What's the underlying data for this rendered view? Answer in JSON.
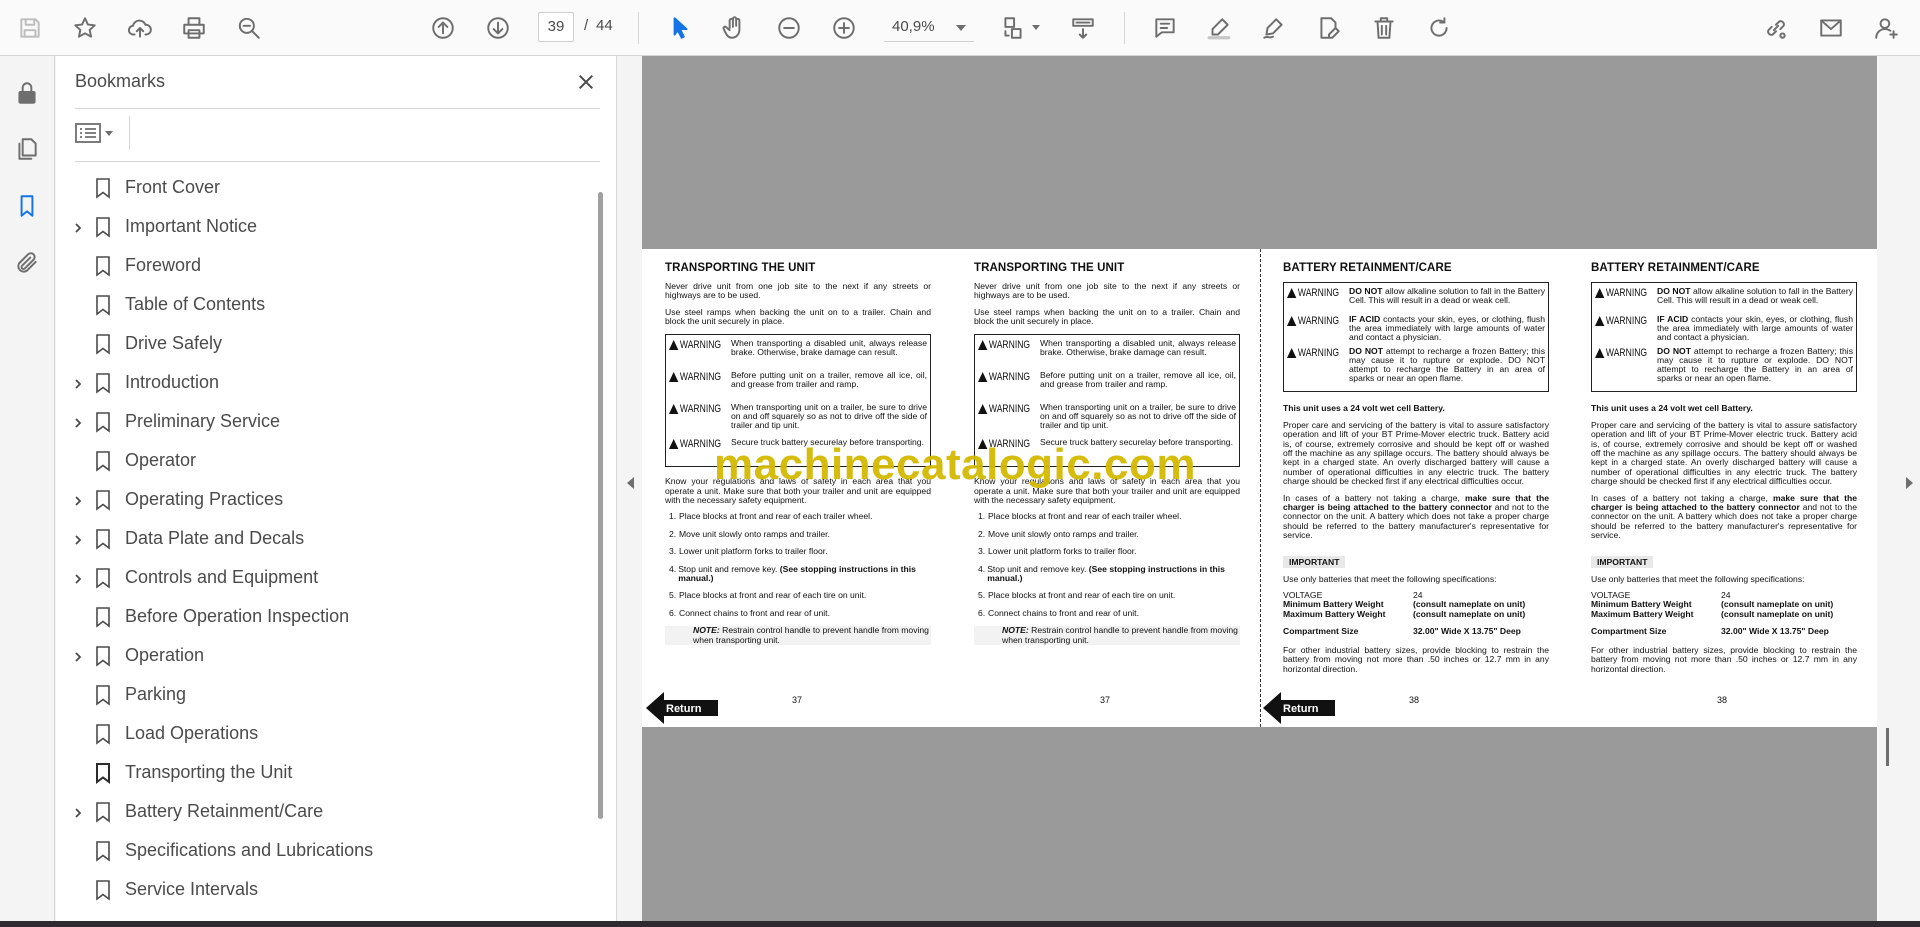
{
  "toolbar": {
    "page_current": "39",
    "page_separator": "/",
    "page_total": "44",
    "zoom": "40,9%"
  },
  "bookmarks_panel": {
    "title": "Bookmarks",
    "items": [
      {
        "label": "Front Cover",
        "expandable": false
      },
      {
        "label": "Important Notice",
        "expandable": true
      },
      {
        "label": "Foreword",
        "expandable": false
      },
      {
        "label": "Table of Contents",
        "expandable": false
      },
      {
        "label": "Drive Safely",
        "expandable": false
      },
      {
        "label": "Introduction",
        "expandable": true
      },
      {
        "label": "Preliminary Service",
        "expandable": true
      },
      {
        "label": "Operator",
        "expandable": false
      },
      {
        "label": "Operating Practices",
        "expandable": true
      },
      {
        "label": "Data Plate and Decals",
        "expandable": true
      },
      {
        "label": "Controls and Equipment",
        "expandable": true
      },
      {
        "label": "Before Operation Inspection",
        "expandable": false
      },
      {
        "label": "Operation",
        "expandable": true
      },
      {
        "label": "Parking",
        "expandable": false
      },
      {
        "label": "Load Operations",
        "expandable": false
      },
      {
        "label": "Transporting the Unit",
        "expandable": false,
        "current": true
      },
      {
        "label": "Battery Retainment/Care",
        "expandable": true
      },
      {
        "label": "Specifications and Lubrications",
        "expandable": false
      },
      {
        "label": "Service Intervals",
        "expandable": false
      }
    ]
  },
  "document": {
    "watermark": "machinecatalogic.com",
    "return_label": "Return",
    "transport": {
      "title": "TRANSPORTING THE UNIT",
      "p1": "Never drive unit from one job site to the next if any streets or highways are to be used.",
      "p2": "Use steel ramps when backing the unit on to a trailer.  Chain and block the unit securely in place.",
      "warning_tag": "WARNING",
      "warnings": [
        "When transporting a disabled unit, always release brake.  Otherwise, brake damage can result.",
        "Before putting unit on a trailer, remove all ice, oil, and grease from trailer and ramp.",
        "When transporting unit on a trailer, be sure to drive on and off squarely so as not to drive off the side of trailer and tip unit.",
        "Secure truck battery securelay before transporting."
      ],
      "p3": "Know your regulations and laws of safety in each area that you operate a unit.  Make sure that both your trailer and unit are equipped with the necessary safety equipment.",
      "steps": [
        {
          "n": "1.",
          "text": "Place blocks at front and rear of each trailer wheel."
        },
        {
          "n": "2.",
          "text": "Move unit slowly onto ramps and trailer."
        },
        {
          "n": "3.",
          "text": "Lower unit platform forks to trailer floor."
        },
        {
          "n": "4.",
          "text": "Stop unit and remove key.",
          "bold": "(See stopping instructions in this manual.)"
        },
        {
          "n": "5.",
          "text": "Place blocks at front and rear of each tire on unit."
        },
        {
          "n": "6.",
          "text": "Connect chains to front and rear of unit."
        }
      ],
      "note_label": "NOTE:",
      "note_text": "Restrain control handle to prevent handle from moving when transporting unit.",
      "page_number": "37"
    },
    "battery": {
      "title": "BATTERY RETAINMENT/CARE",
      "warning_tag": "WARNING",
      "warnings": [
        {
          "bold": "DO NOT",
          "text": " allow alkaline solution to fall in the Battery Cell.  This will result in a dead or weak cell."
        },
        {
          "bold": "IF ACID",
          "text": " contacts your skin, eyes, or clothing, flush the area immediately with large amounts of water and contact a physician."
        },
        {
          "bold": "DO NOT",
          "text": " attempt to recharge a frozen Battery; this may cause it to rupture or explode.  DO NOT attempt to recharge the Battery in an area of sparks or near an open flame."
        }
      ],
      "p1": "This unit uses a 24 volt wet cell Battery.",
      "p2": "Proper care and servicing of the battery is vital to assure satisfactory operation and lift of your BT Prime-Mover electric truck.  Battery acid is, of course, extremely corrosive and should be kept off or washed off the machine as any spillage occurs. The battery should always be kept in a charged state.  An overly discharged battery will cause a number of operational difficulties in any electric truck.  The battery charge should be checked first if any electrical difficulties occur.",
      "p3a": "In cases of a battery not taking a charge, ",
      "p3b": "make sure that the charger is being attached to the battery connector",
      "p3c": " and not to the connector on the unit.  A battery which does not take a proper charge should be referred to the battery manufacturer's representative for service.",
      "important": "IMPORTANT",
      "p4": "Use only batteries that meet the following specifications:",
      "specs": [
        {
          "k": "VOLTAGE",
          "v": "24"
        },
        {
          "k": "Minimum Battery Weight",
          "v": "(consult nameplate on unit)"
        },
        {
          "k": "Maximum Battery Weight",
          "v": "(consult nameplate on unit)"
        },
        {
          "k": "Compartment Size",
          "v": "32.00\" Wide X 13.75\" Deep"
        }
      ],
      "p5": "For other industrial battery sizes, provide blocking to restrain the battery from moving not more than .50 inches or 12.7 mm in any horizontal direction.",
      "page_number": "38"
    }
  },
  "colors": {
    "accent": "#1473e6",
    "watermark": "#d4b900",
    "page_gray": "#9a9a9a"
  }
}
